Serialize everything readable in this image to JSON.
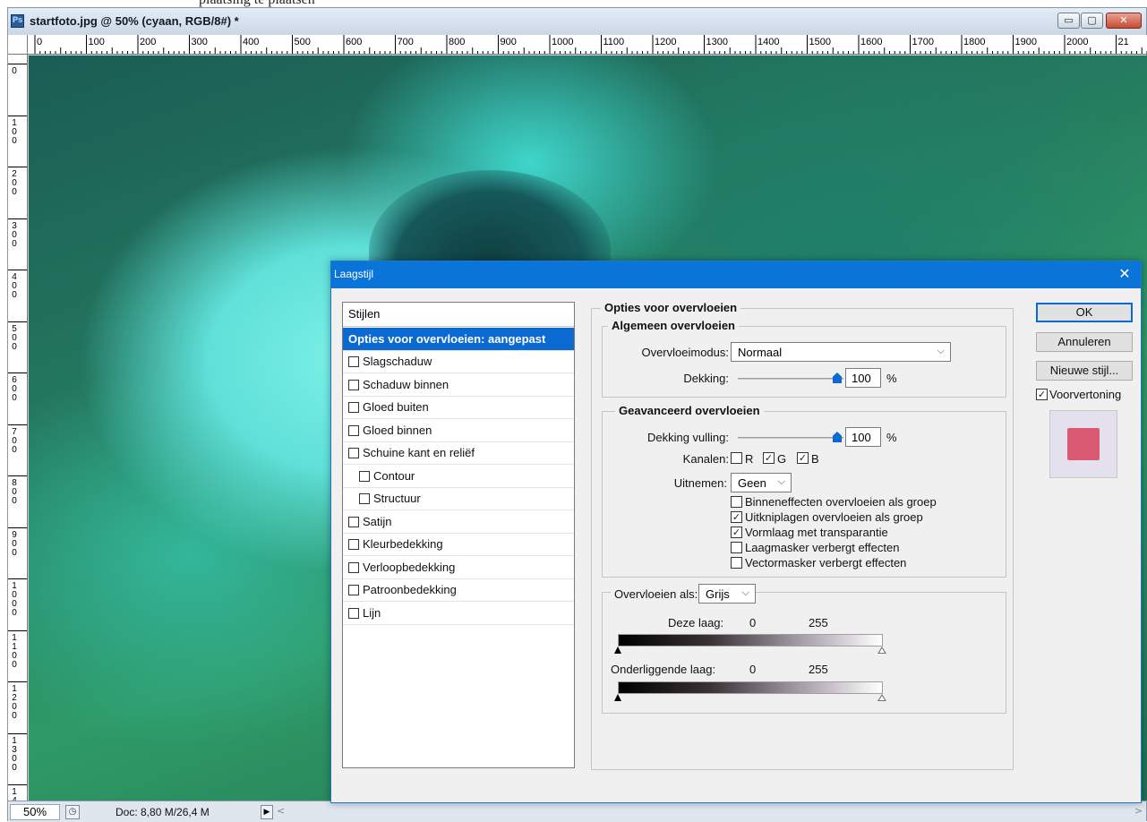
{
  "top_strip": {
    "partial_text": "plaatsing te plaatsen"
  },
  "window": {
    "app_icon": "Ps",
    "title": "startfoto.jpg @ 50% (cyaan, RGB/8#) *",
    "buttons": {
      "minimize": "▭",
      "maximize": "▢",
      "close": "✕"
    }
  },
  "ruler": {
    "h_labels": [
      "0",
      "100",
      "200",
      "300",
      "400",
      "500",
      "600",
      "700",
      "800",
      "900",
      "1000",
      "1100",
      "1200",
      "1300",
      "1400",
      "1500",
      "1600",
      "1700",
      "1800",
      "1900",
      "2000",
      "21"
    ],
    "v_labels": [
      "0",
      "100",
      "200",
      "300",
      "400",
      "500",
      "600",
      "700",
      "800",
      "900",
      "1000",
      "1100",
      "1200",
      "1300",
      "14"
    ]
  },
  "status": {
    "zoom": "50%",
    "doc_info": "Doc: 8,80 M/26,4 M",
    "arrow": "▶",
    "scroll_left": "<",
    "scroll_right": ">"
  },
  "dialog": {
    "title": "Laagstijl",
    "close_glyph": "✕",
    "styles_header": "Stijlen",
    "styles": [
      {
        "label": "Opties voor overvloeien: aangepast",
        "selected": true
      },
      {
        "label": "Slagschaduw",
        "checked": false
      },
      {
        "label": "Schaduw binnen",
        "checked": false
      },
      {
        "label": "Gloed buiten",
        "checked": false
      },
      {
        "label": "Gloed binnen",
        "checked": false
      },
      {
        "label": "Schuine kant en reliëf",
        "checked": false
      },
      {
        "label": "Contour",
        "checked": false,
        "indent": true
      },
      {
        "label": "Structuur",
        "checked": false,
        "indent": true
      },
      {
        "label": "Satijn",
        "checked": false
      },
      {
        "label": "Kleurbedekking",
        "checked": false
      },
      {
        "label": "Verloopbedekking",
        "checked": false
      },
      {
        "label": "Patroonbedekking",
        "checked": false
      },
      {
        "label": "Lijn",
        "checked": false
      }
    ],
    "blending": {
      "section_title": "Opties voor overvloeien",
      "general_title": "Algemeen overvloeien",
      "mode_label": "Overvloeimodus:",
      "mode_value": "Normaal",
      "opacity_label": "Dekking:",
      "opacity_value": "100",
      "percent": "%",
      "advanced_title": "Geavanceerd overvloeien",
      "fill_label": "Dekking vulling:",
      "fill_value": "100",
      "channels_label": "Kanalen:",
      "channels": [
        {
          "name": "R",
          "checked": false
        },
        {
          "name": "G",
          "checked": true
        },
        {
          "name": "B",
          "checked": true
        }
      ],
      "knockout_label": "Uitnemen:",
      "knockout_value": "Geen",
      "options": [
        {
          "label": "Binneneffecten overvloeien als groep",
          "checked": false
        },
        {
          "label": "Uitkniplagen overvloeien als groep",
          "checked": true
        },
        {
          "label": "Vormlaag met transparantie",
          "checked": true
        },
        {
          "label": "Laagmasker verbergt effecten",
          "checked": false
        },
        {
          "label": "Vectormasker verbergt effecten",
          "checked": false
        }
      ],
      "blend_if_label": "Overvloeien als:",
      "blend_if_value": "Grijs",
      "this_layer_label": "Deze laag:",
      "this_layer_min": "0",
      "this_layer_max": "255",
      "underlying_label": "Onderliggende laag:",
      "underlying_min": "0",
      "underlying_max": "255"
    },
    "buttons": {
      "ok": "OK",
      "cancel": "Annuleren",
      "new_style": "Nieuwe stijl...",
      "preview_label": "Voorvertoning",
      "preview_checked": true
    },
    "check_glyph": "✓",
    "chevron_glyph": "⌵",
    "preview_color": "#d95a72"
  },
  "colors": {
    "accent": "#0b6ad2",
    "canvas_cyan": "#5fe0d8",
    "canvas_green": "#247a5f"
  }
}
